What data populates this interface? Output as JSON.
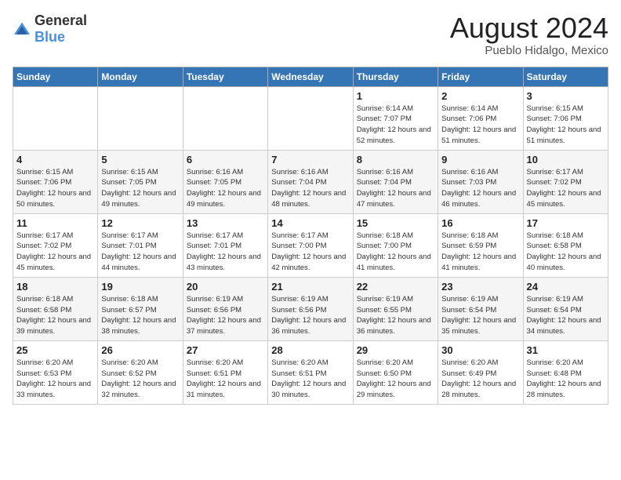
{
  "header": {
    "logo_general": "General",
    "logo_blue": "Blue",
    "title": "August 2024",
    "subtitle": "Pueblo Hidalgo, Mexico"
  },
  "days_of_week": [
    "Sunday",
    "Monday",
    "Tuesday",
    "Wednesday",
    "Thursday",
    "Friday",
    "Saturday"
  ],
  "weeks": [
    [
      {
        "day": "",
        "sunrise": "",
        "sunset": "",
        "daylight": ""
      },
      {
        "day": "",
        "sunrise": "",
        "sunset": "",
        "daylight": ""
      },
      {
        "day": "",
        "sunrise": "",
        "sunset": "",
        "daylight": ""
      },
      {
        "day": "",
        "sunrise": "",
        "sunset": "",
        "daylight": ""
      },
      {
        "day": "1",
        "sunrise": "Sunrise: 6:14 AM",
        "sunset": "Sunset: 7:07 PM",
        "daylight": "Daylight: 12 hours and 52 minutes."
      },
      {
        "day": "2",
        "sunrise": "Sunrise: 6:14 AM",
        "sunset": "Sunset: 7:06 PM",
        "daylight": "Daylight: 12 hours and 51 minutes."
      },
      {
        "day": "3",
        "sunrise": "Sunrise: 6:15 AM",
        "sunset": "Sunset: 7:06 PM",
        "daylight": "Daylight: 12 hours and 51 minutes."
      }
    ],
    [
      {
        "day": "4",
        "sunrise": "Sunrise: 6:15 AM",
        "sunset": "Sunset: 7:06 PM",
        "daylight": "Daylight: 12 hours and 50 minutes."
      },
      {
        "day": "5",
        "sunrise": "Sunrise: 6:15 AM",
        "sunset": "Sunset: 7:05 PM",
        "daylight": "Daylight: 12 hours and 49 minutes."
      },
      {
        "day": "6",
        "sunrise": "Sunrise: 6:16 AM",
        "sunset": "Sunset: 7:05 PM",
        "daylight": "Daylight: 12 hours and 49 minutes."
      },
      {
        "day": "7",
        "sunrise": "Sunrise: 6:16 AM",
        "sunset": "Sunset: 7:04 PM",
        "daylight": "Daylight: 12 hours and 48 minutes."
      },
      {
        "day": "8",
        "sunrise": "Sunrise: 6:16 AM",
        "sunset": "Sunset: 7:04 PM",
        "daylight": "Daylight: 12 hours and 47 minutes."
      },
      {
        "day": "9",
        "sunrise": "Sunrise: 6:16 AM",
        "sunset": "Sunset: 7:03 PM",
        "daylight": "Daylight: 12 hours and 46 minutes."
      },
      {
        "day": "10",
        "sunrise": "Sunrise: 6:17 AM",
        "sunset": "Sunset: 7:02 PM",
        "daylight": "Daylight: 12 hours and 45 minutes."
      }
    ],
    [
      {
        "day": "11",
        "sunrise": "Sunrise: 6:17 AM",
        "sunset": "Sunset: 7:02 PM",
        "daylight": "Daylight: 12 hours and 45 minutes."
      },
      {
        "day": "12",
        "sunrise": "Sunrise: 6:17 AM",
        "sunset": "Sunset: 7:01 PM",
        "daylight": "Daylight: 12 hours and 44 minutes."
      },
      {
        "day": "13",
        "sunrise": "Sunrise: 6:17 AM",
        "sunset": "Sunset: 7:01 PM",
        "daylight": "Daylight: 12 hours and 43 minutes."
      },
      {
        "day": "14",
        "sunrise": "Sunrise: 6:17 AM",
        "sunset": "Sunset: 7:00 PM",
        "daylight": "Daylight: 12 hours and 42 minutes."
      },
      {
        "day": "15",
        "sunrise": "Sunrise: 6:18 AM",
        "sunset": "Sunset: 7:00 PM",
        "daylight": "Daylight: 12 hours and 41 minutes."
      },
      {
        "day": "16",
        "sunrise": "Sunrise: 6:18 AM",
        "sunset": "Sunset: 6:59 PM",
        "daylight": "Daylight: 12 hours and 41 minutes."
      },
      {
        "day": "17",
        "sunrise": "Sunrise: 6:18 AM",
        "sunset": "Sunset: 6:58 PM",
        "daylight": "Daylight: 12 hours and 40 minutes."
      }
    ],
    [
      {
        "day": "18",
        "sunrise": "Sunrise: 6:18 AM",
        "sunset": "Sunset: 6:58 PM",
        "daylight": "Daylight: 12 hours and 39 minutes."
      },
      {
        "day": "19",
        "sunrise": "Sunrise: 6:18 AM",
        "sunset": "Sunset: 6:57 PM",
        "daylight": "Daylight: 12 hours and 38 minutes."
      },
      {
        "day": "20",
        "sunrise": "Sunrise: 6:19 AM",
        "sunset": "Sunset: 6:56 PM",
        "daylight": "Daylight: 12 hours and 37 minutes."
      },
      {
        "day": "21",
        "sunrise": "Sunrise: 6:19 AM",
        "sunset": "Sunset: 6:56 PM",
        "daylight": "Daylight: 12 hours and 36 minutes."
      },
      {
        "day": "22",
        "sunrise": "Sunrise: 6:19 AM",
        "sunset": "Sunset: 6:55 PM",
        "daylight": "Daylight: 12 hours and 36 minutes."
      },
      {
        "day": "23",
        "sunrise": "Sunrise: 6:19 AM",
        "sunset": "Sunset: 6:54 PM",
        "daylight": "Daylight: 12 hours and 35 minutes."
      },
      {
        "day": "24",
        "sunrise": "Sunrise: 6:19 AM",
        "sunset": "Sunset: 6:54 PM",
        "daylight": "Daylight: 12 hours and 34 minutes."
      }
    ],
    [
      {
        "day": "25",
        "sunrise": "Sunrise: 6:20 AM",
        "sunset": "Sunset: 6:53 PM",
        "daylight": "Daylight: 12 hours and 33 minutes."
      },
      {
        "day": "26",
        "sunrise": "Sunrise: 6:20 AM",
        "sunset": "Sunset: 6:52 PM",
        "daylight": "Daylight: 12 hours and 32 minutes."
      },
      {
        "day": "27",
        "sunrise": "Sunrise: 6:20 AM",
        "sunset": "Sunset: 6:51 PM",
        "daylight": "Daylight: 12 hours and 31 minutes."
      },
      {
        "day": "28",
        "sunrise": "Sunrise: 6:20 AM",
        "sunset": "Sunset: 6:51 PM",
        "daylight": "Daylight: 12 hours and 30 minutes."
      },
      {
        "day": "29",
        "sunrise": "Sunrise: 6:20 AM",
        "sunset": "Sunset: 6:50 PM",
        "daylight": "Daylight: 12 hours and 29 minutes."
      },
      {
        "day": "30",
        "sunrise": "Sunrise: 6:20 AM",
        "sunset": "Sunset: 6:49 PM",
        "daylight": "Daylight: 12 hours and 28 minutes."
      },
      {
        "day": "31",
        "sunrise": "Sunrise: 6:20 AM",
        "sunset": "Sunset: 6:48 PM",
        "daylight": "Daylight: 12 hours and 28 minutes."
      }
    ]
  ]
}
